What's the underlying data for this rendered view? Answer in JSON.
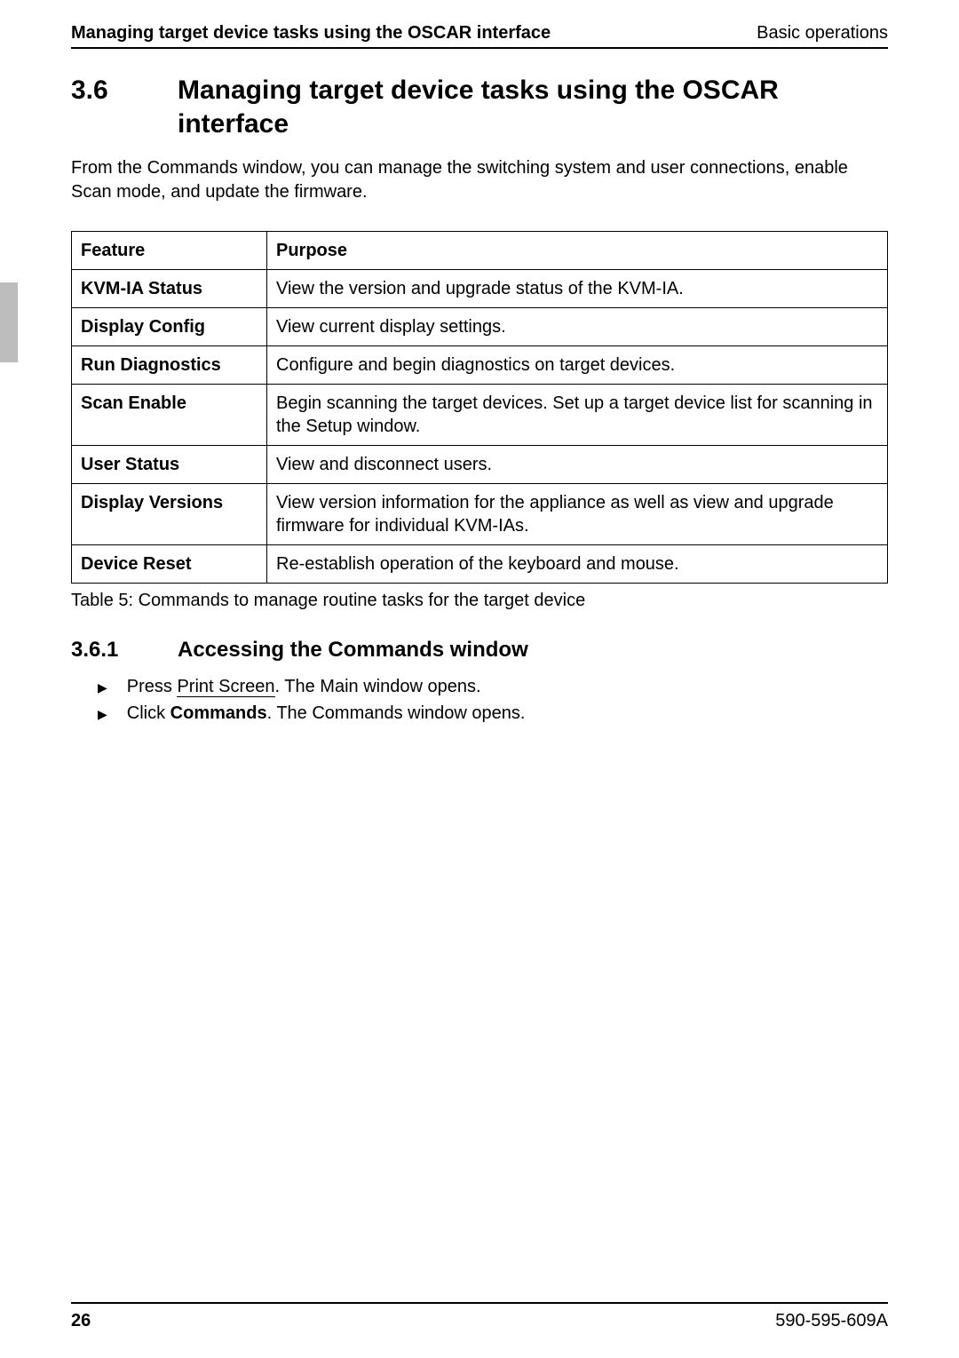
{
  "header": {
    "left": "Managing target device tasks using the OSCAR interface",
    "right": "Basic operations"
  },
  "section": {
    "num": "3.6",
    "title": "Managing target device tasks using the OSCAR interface",
    "intro": "From the Commands window, you can manage the switching system and user connections, enable Scan mode, and update the firmware."
  },
  "table": {
    "head": {
      "feature": "Feature",
      "purpose": "Purpose"
    },
    "rows": [
      {
        "feature": "KVM-IA Status",
        "purpose": "View the version and upgrade status of the KVM-IA."
      },
      {
        "feature": "Display Config",
        "purpose": "View current display settings."
      },
      {
        "feature": "Run Diagnostics",
        "purpose": "Configure and begin diagnostics on target devices."
      },
      {
        "feature": "Scan Enable",
        "purpose": "Begin scanning the target devices. Set up a target device list for scanning in the Setup window."
      },
      {
        "feature": "User Status",
        "purpose": "View and disconnect users."
      },
      {
        "feature": "Display Versions",
        "purpose": "View version information for the appliance as well as view and upgrade firmware for individual KVM-IAs."
      },
      {
        "feature": "Device Reset",
        "purpose": "Re-establish operation of the keyboard and mouse."
      }
    ],
    "caption": "Table 5: Commands to manage routine tasks for the target device"
  },
  "subsection": {
    "num": "3.6.1",
    "title": "Accessing the Commands window"
  },
  "steps": [
    {
      "prefix": "Press ",
      "key": "Print Screen",
      "suffix": ". The Main window opens."
    },
    {
      "prefix": "Click ",
      "bold": "Commands",
      "suffix": ". The Commands window opens."
    }
  ],
  "footer": {
    "page": "26",
    "docnum": "590-595-609A"
  }
}
